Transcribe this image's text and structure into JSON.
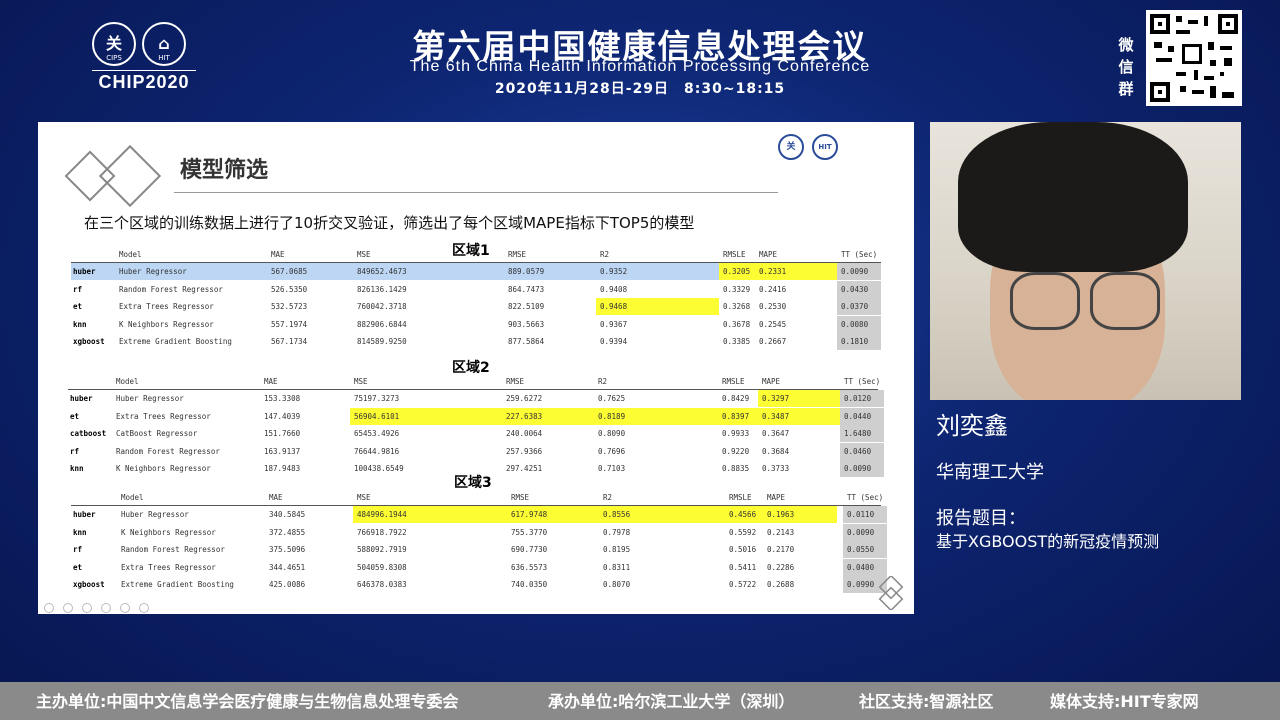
{
  "header": {
    "logo_text": "CHIP2020",
    "logo_left_glyph": "关",
    "logo_left_sub": "CIPS",
    "logo_right_sub": "HIT",
    "title": "第六届中国健康信息处理会议",
    "subtitle": "The 6th China Health Information Processing Conference",
    "date": "2020年11月28日-29日　8:30~18:15",
    "wechat_label": "微信群"
  },
  "slide": {
    "title": "模型筛选",
    "description": "在三个区域的训练数据上进行了10折交叉验证，筛选出了每个区域MAPE指标下TOP5的模型",
    "logo1": "关",
    "logo2": "HIT",
    "columns": [
      "Model",
      "MAE",
      "MSE",
      "RMSE",
      "R2",
      "RMSLE",
      "MAPE",
      "TT (Sec)"
    ],
    "regions": [
      {
        "label": "区域1",
        "rows": [
          {
            "idx": "huber",
            "model": "Huber Regressor",
            "mae": "567.0685",
            "mse": "849652.4673",
            "rmse": "889.0579",
            "r2": "0.9352",
            "rmsle": "0.3205",
            "mape": "0.2331",
            "tt": "0.0090"
          },
          {
            "idx": "rf",
            "model": "Random Forest Regressor",
            "mae": "526.5350",
            "mse": "826136.1429",
            "rmse": "864.7473",
            "r2": "0.9408",
            "rmsle": "0.3329",
            "mape": "0.2416",
            "tt": "0.0430"
          },
          {
            "idx": "et",
            "model": "Extra Trees Regressor",
            "mae": "532.5723",
            "mse": "760042.3718",
            "rmse": "822.5109",
            "r2": "0.9468",
            "rmsle": "0.3268",
            "mape": "0.2530",
            "tt": "0.0370"
          },
          {
            "idx": "knn",
            "model": "K Neighbors Regressor",
            "mae": "557.1974",
            "mse": "882906.6844",
            "rmse": "903.5663",
            "r2": "0.9367",
            "rmsle": "0.3678",
            "mape": "0.2545",
            "tt": "0.0080"
          },
          {
            "idx": "xgboost",
            "model": "Extreme Gradient Boosting",
            "mae": "567.1734",
            "mse": "814589.9250",
            "rmse": "877.5864",
            "r2": "0.9394",
            "rmsle": "0.3385",
            "mape": "0.2667",
            "tt": "0.1810"
          }
        ]
      },
      {
        "label": "区域2",
        "rows": [
          {
            "idx": "huber",
            "model": "Huber Regressor",
            "mae": "153.3308",
            "mse": "75197.3273",
            "rmse": "259.6272",
            "r2": "0.7625",
            "rmsle": "0.8429",
            "mape": "0.3297",
            "tt": "0.0120"
          },
          {
            "idx": "et",
            "model": "Extra Trees Regressor",
            "mae": "147.4039",
            "mse": "56904.6101",
            "rmse": "227.6383",
            "r2": "0.8189",
            "rmsle": "0.8397",
            "mape": "0.3487",
            "tt": "0.0440"
          },
          {
            "idx": "catboost",
            "model": "CatBoost Regressor",
            "mae": "151.7660",
            "mse": "65453.4926",
            "rmse": "240.0064",
            "r2": "0.8090",
            "rmsle": "0.9933",
            "mape": "0.3647",
            "tt": "1.6480"
          },
          {
            "idx": "rf",
            "model": "Random Forest Regressor",
            "mae": "163.9137",
            "mse": "76644.9816",
            "rmse": "257.9366",
            "r2": "0.7696",
            "rmsle": "0.9220",
            "mape": "0.3684",
            "tt": "0.0460"
          },
          {
            "idx": "knn",
            "model": "K Neighbors Regressor",
            "mae": "187.9483",
            "mse": "100438.6549",
            "rmse": "297.4251",
            "r2": "0.7103",
            "rmsle": "0.8835",
            "mape": "0.3733",
            "tt": "0.0090"
          }
        ]
      },
      {
        "label": "区域3",
        "rows": [
          {
            "idx": "huber",
            "model": "Huber Regressor",
            "mae": "340.5845",
            "mse": "484996.1944",
            "rmse": "617.9748",
            "r2": "0.8556",
            "rmsle": "0.4566",
            "mape": "0.1963",
            "tt": "0.0110"
          },
          {
            "idx": "knn",
            "model": "K Neighbors Regressor",
            "mae": "372.4855",
            "mse": "766918.7922",
            "rmse": "755.3770",
            "r2": "0.7978",
            "rmsle": "0.5592",
            "mape": "0.2143",
            "tt": "0.0090"
          },
          {
            "idx": "rf",
            "model": "Random Forest Regressor",
            "mae": "375.5096",
            "mse": "588092.7919",
            "rmse": "690.7730",
            "r2": "0.8195",
            "rmsle": "0.5016",
            "mape": "0.2170",
            "tt": "0.0550"
          },
          {
            "idx": "et",
            "model": "Extra Trees Regressor",
            "mae": "344.4651",
            "mse": "504059.8308",
            "rmse": "636.5573",
            "r2": "0.8311",
            "rmsle": "0.5411",
            "mape": "0.2286",
            "tt": "0.0400"
          },
          {
            "idx": "xgboost",
            "model": "Extreme Gradient Boosting",
            "mae": "425.0086",
            "mse": "646378.0383",
            "rmse": "740.0350",
            "r2": "0.8070",
            "rmsle": "0.5722",
            "mape": "0.2688",
            "tt": "0.0990"
          }
        ]
      }
    ]
  },
  "speaker": {
    "name": "刘奕鑫",
    "affiliation": "华南理工大学",
    "topic_label": "报告题目：",
    "topic": "基于XGBOOST的新冠疫情预测"
  },
  "footer": {
    "organizer": "主办单位:中国中文信息学会医疗健康与生物信息处理专委会",
    "host": "承办单位:哈尔滨工业大学（深圳）",
    "community": "社区支持:智源社区",
    "media": "媒体支持:HIT专家网"
  },
  "colors": {
    "background": "#0d2470",
    "highlight_yellow": "#fdfd34",
    "highlight_blue": "#bcd6f4",
    "tt_column": "#cfcfcf",
    "footer": "#8a8a8a"
  }
}
